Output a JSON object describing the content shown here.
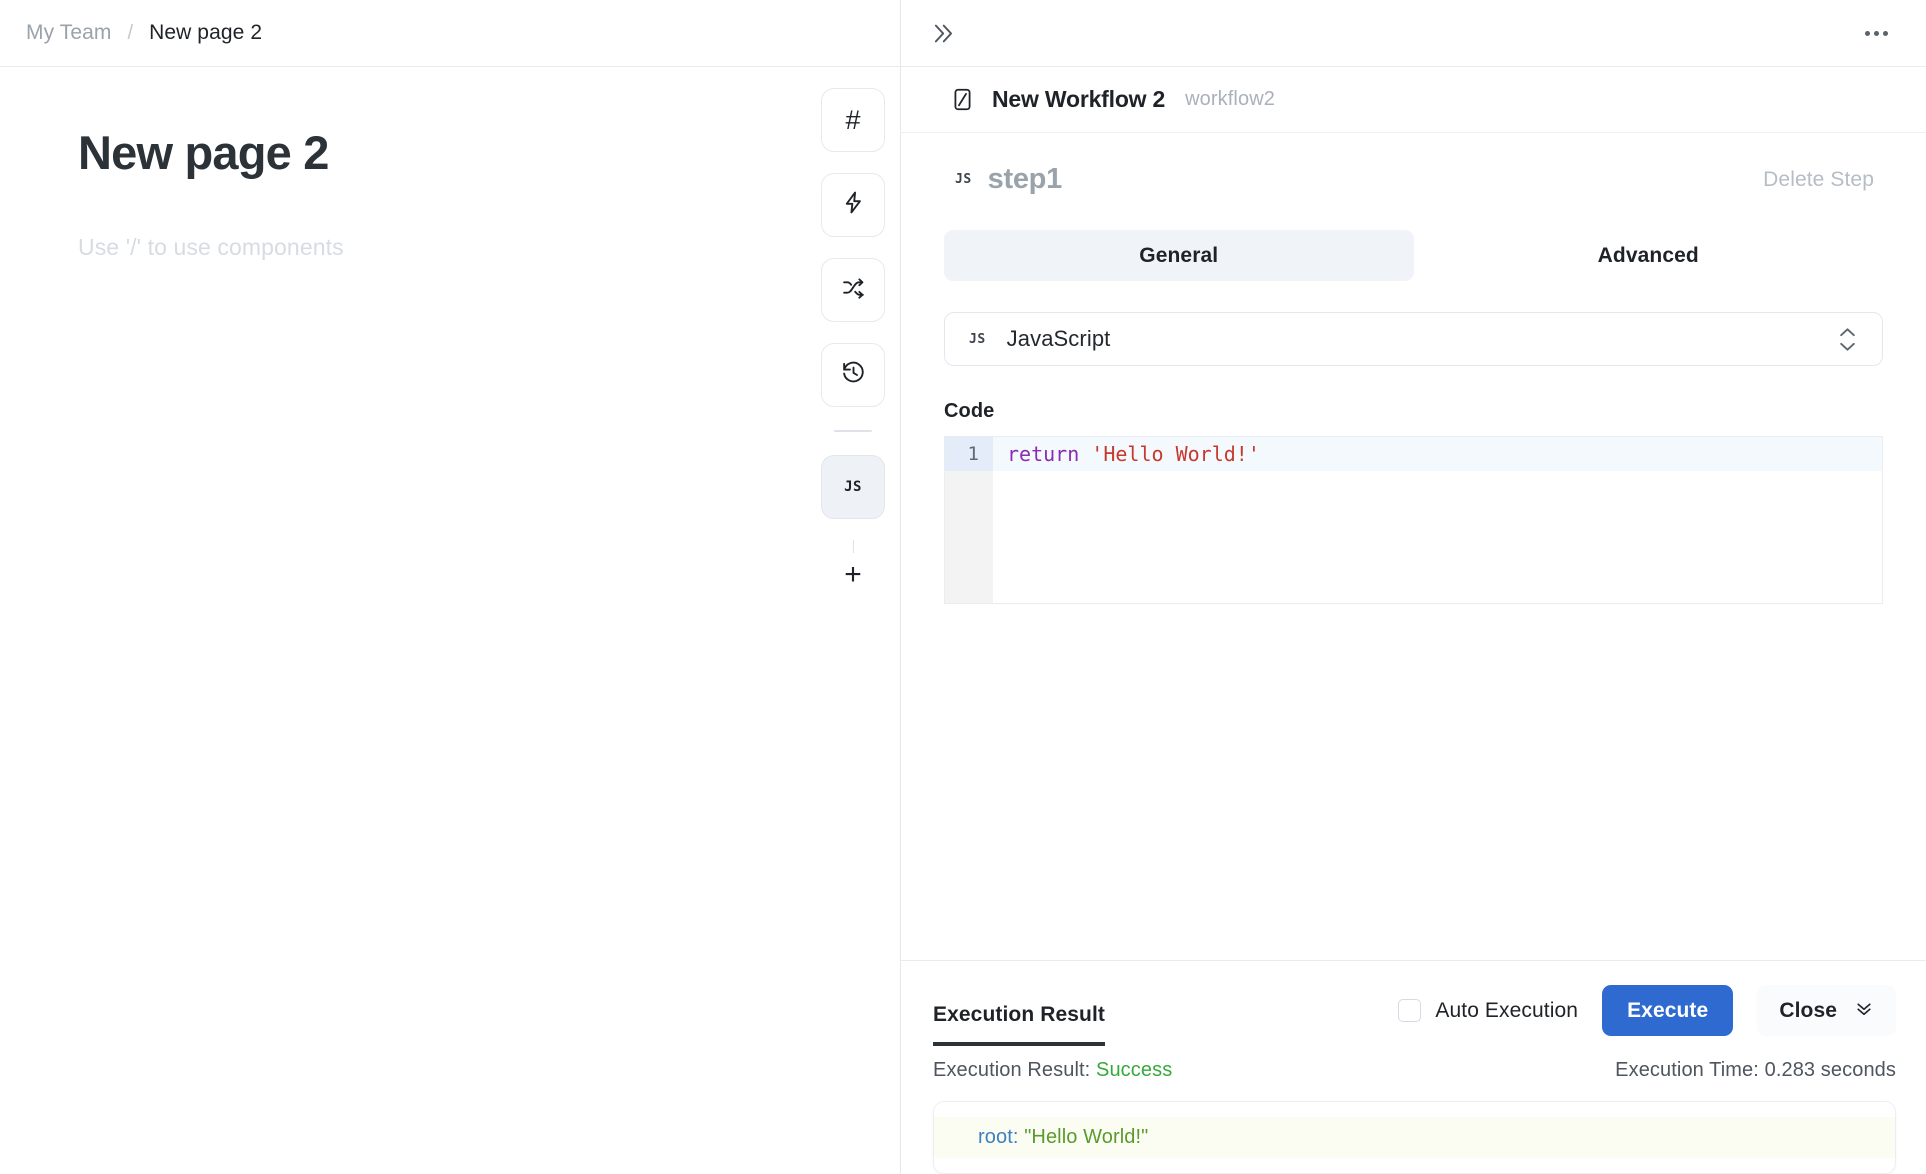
{
  "left": {
    "breadcrumb": {
      "team": "My Team",
      "separator": "/",
      "page": "New page 2"
    },
    "document": {
      "title": "New page 2",
      "placeholder": "Use '/' to use components"
    },
    "toolbar": {
      "items": [
        {
          "name": "heading-icon",
          "glyph": "#"
        },
        {
          "name": "lightning-icon",
          "glyph": ""
        },
        {
          "name": "branch-icon",
          "glyph": ""
        },
        {
          "name": "history-icon",
          "glyph": ""
        }
      ],
      "js_step_label": "JS",
      "add_label": "+"
    }
  },
  "panel": {
    "topbar": {
      "expand_icon": "chevron-double-right-icon",
      "more_icon": "more-horizontal-icon"
    },
    "workflow": {
      "icon": "workflow-icon",
      "name": "New Workflow 2",
      "id": "workflow2"
    },
    "step": {
      "badge": "JS",
      "name": "step1",
      "delete_label": "Delete Step"
    },
    "tabs": [
      {
        "label": "General",
        "active": true
      },
      {
        "label": "Advanced",
        "active": false
      }
    ],
    "language_select": {
      "badge": "JS",
      "value": "JavaScript",
      "stepper_icon": "chevron-up-down-icon"
    },
    "code": {
      "label": "Code",
      "lines": [
        {
          "number": "1",
          "keyword": "return",
          "space": " ",
          "string": "'Hello World!'"
        }
      ]
    },
    "execution": {
      "tab_label": "Execution Result",
      "auto_execution_label": "Auto Execution",
      "auto_execution_checked": false,
      "execute_label": "Execute",
      "close_label": "Close",
      "close_icon": "chevron-double-down-icon",
      "result_prefix": "Execution Result:",
      "result_status": "Success",
      "time_label": "Execution Time: 0.283 seconds",
      "output_key": "root:",
      "output_value": "\"Hello World!\""
    }
  },
  "colors": {
    "accent_blue": "#2f6ad0",
    "success_green": "#37a93c",
    "tab_active_bg": "#f0f3f8",
    "code_keyword": "#8b2bb3",
    "code_string": "#c7392f"
  }
}
